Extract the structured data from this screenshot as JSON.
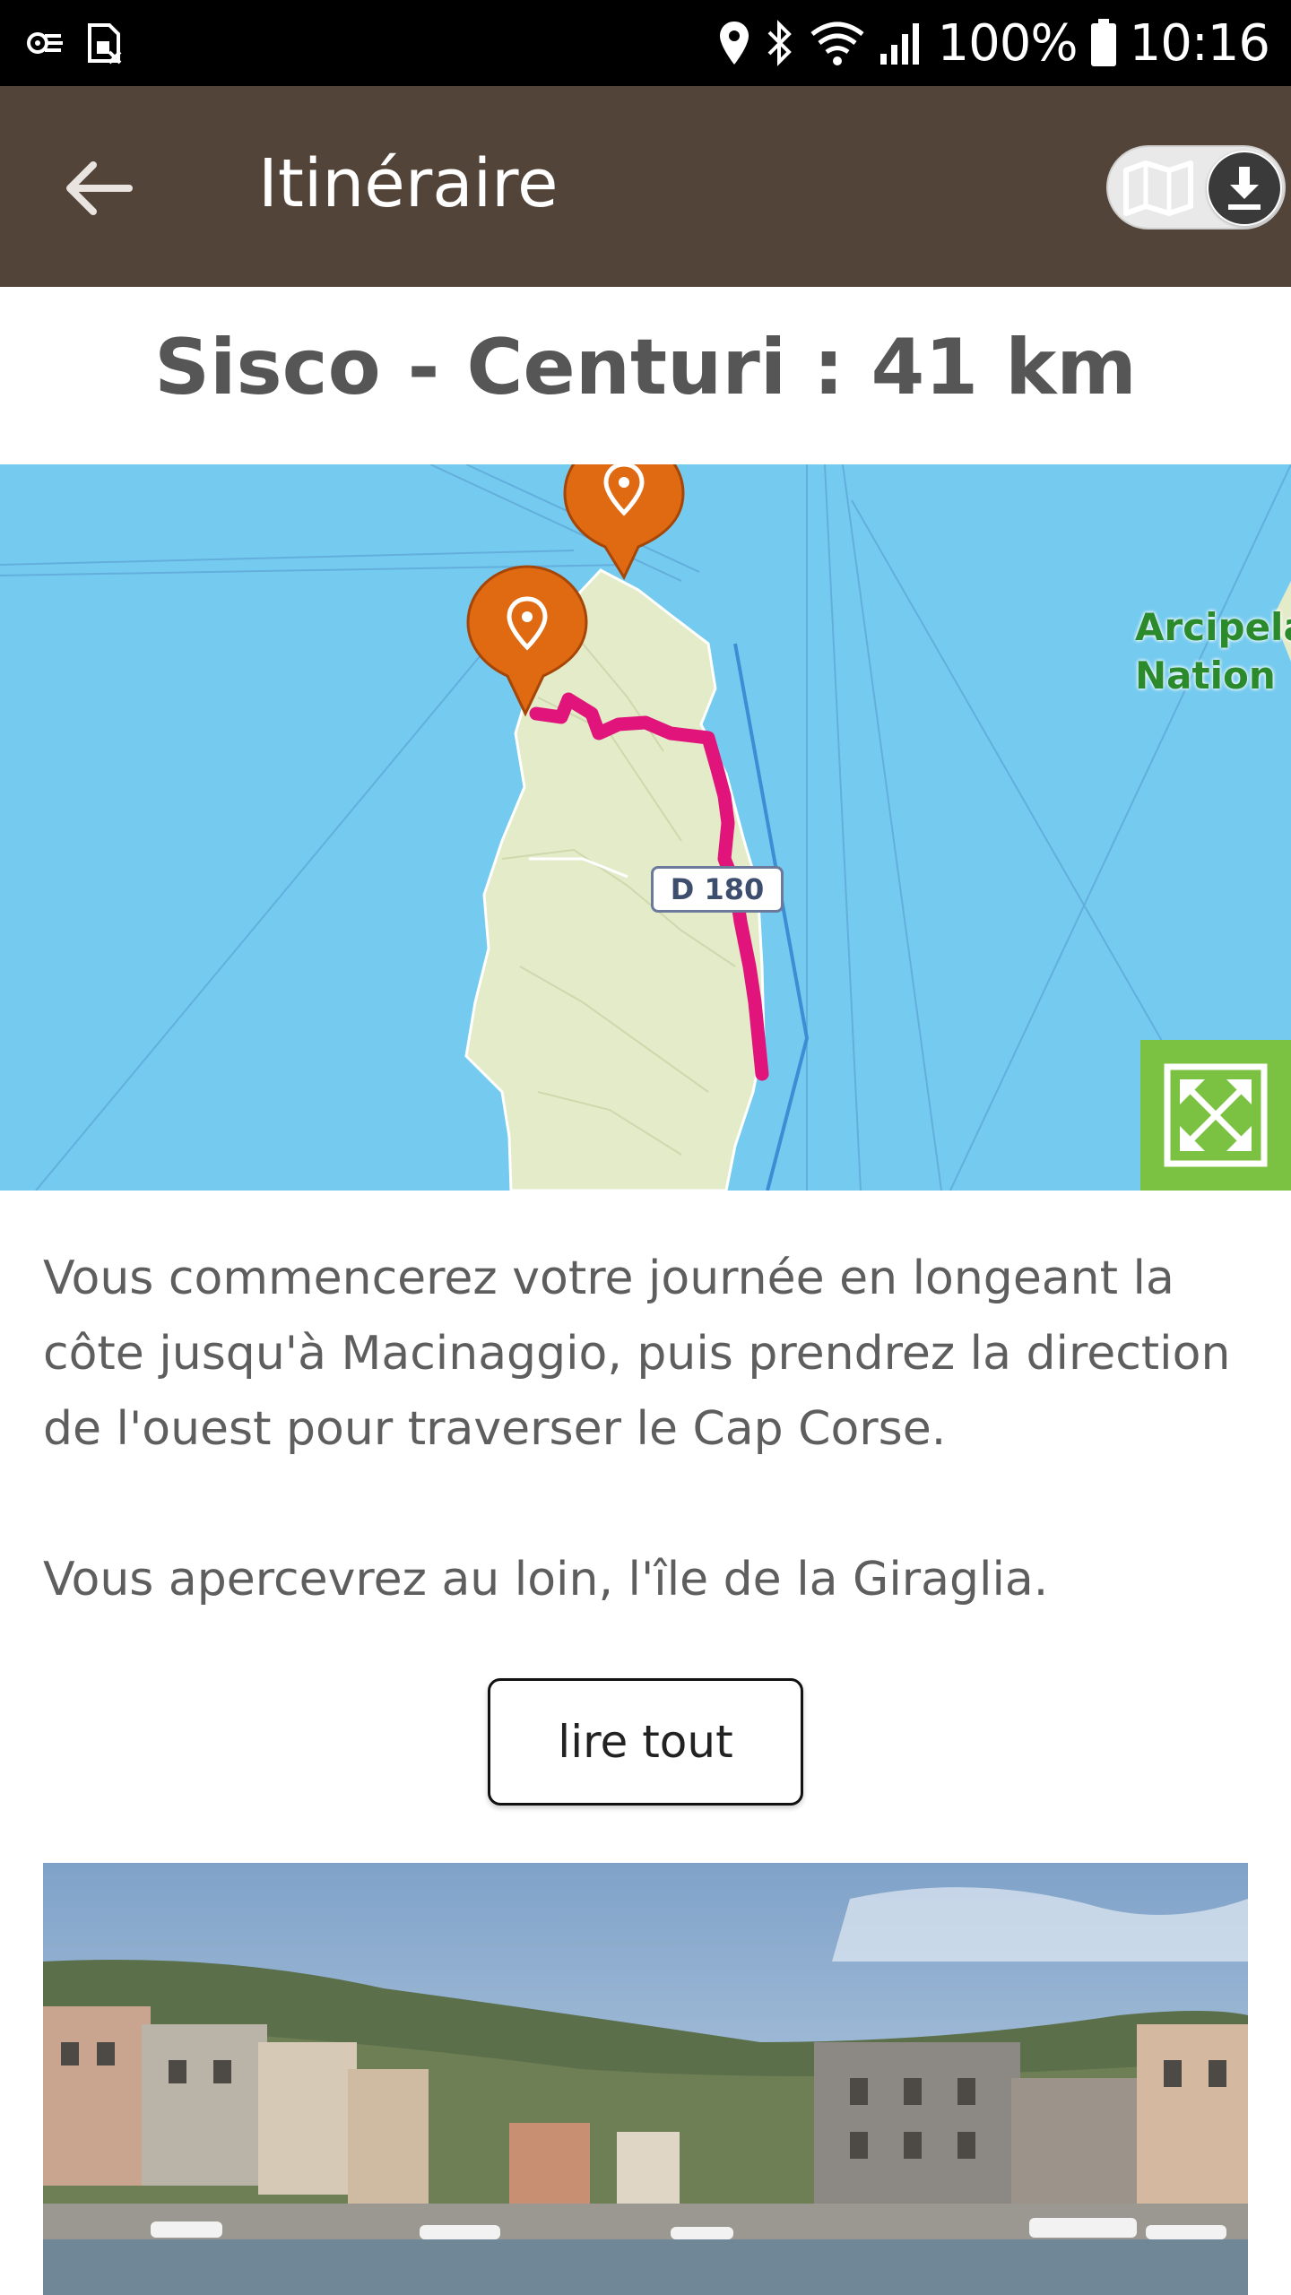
{
  "status_bar": {
    "battery_percent": "100%",
    "time": "10:16",
    "icons": [
      "cast-icon",
      "sim-disabled-icon",
      "location-icon",
      "bluetooth-icon",
      "wifi-icon",
      "signal-icon",
      "battery-icon"
    ]
  },
  "app_bar": {
    "title": "Itinéraire",
    "back_icon": "arrow-left-icon",
    "toggle_icons": [
      "map-icon",
      "download-icon"
    ]
  },
  "route": {
    "title": "Sisco - Centuri : 41 km"
  },
  "map": {
    "area_label": "Arcipela\nNation",
    "road_label": "D 180",
    "markers": [
      "map-pin-icon",
      "map-pin-icon"
    ],
    "expand_icon": "expand-icon",
    "colors": {
      "sea": "#74cbef",
      "land": "#e4ebc9",
      "route": "#e0147a",
      "marker": "#e06a12",
      "expand_button": "#7cc242"
    }
  },
  "description": {
    "paragraph_1": "Vous commencerez votre journée en longeant la côte jusqu'à Macinaggio, puis prendrez la direction de l'ouest pour traverser le Cap Corse.",
    "paragraph_2": "Vous apercevrez au loin, l'île de la Giraglia."
  },
  "read_more_label": "lire tout",
  "colors": {
    "app_bar": "#524439",
    "status_bar": "#000000"
  }
}
